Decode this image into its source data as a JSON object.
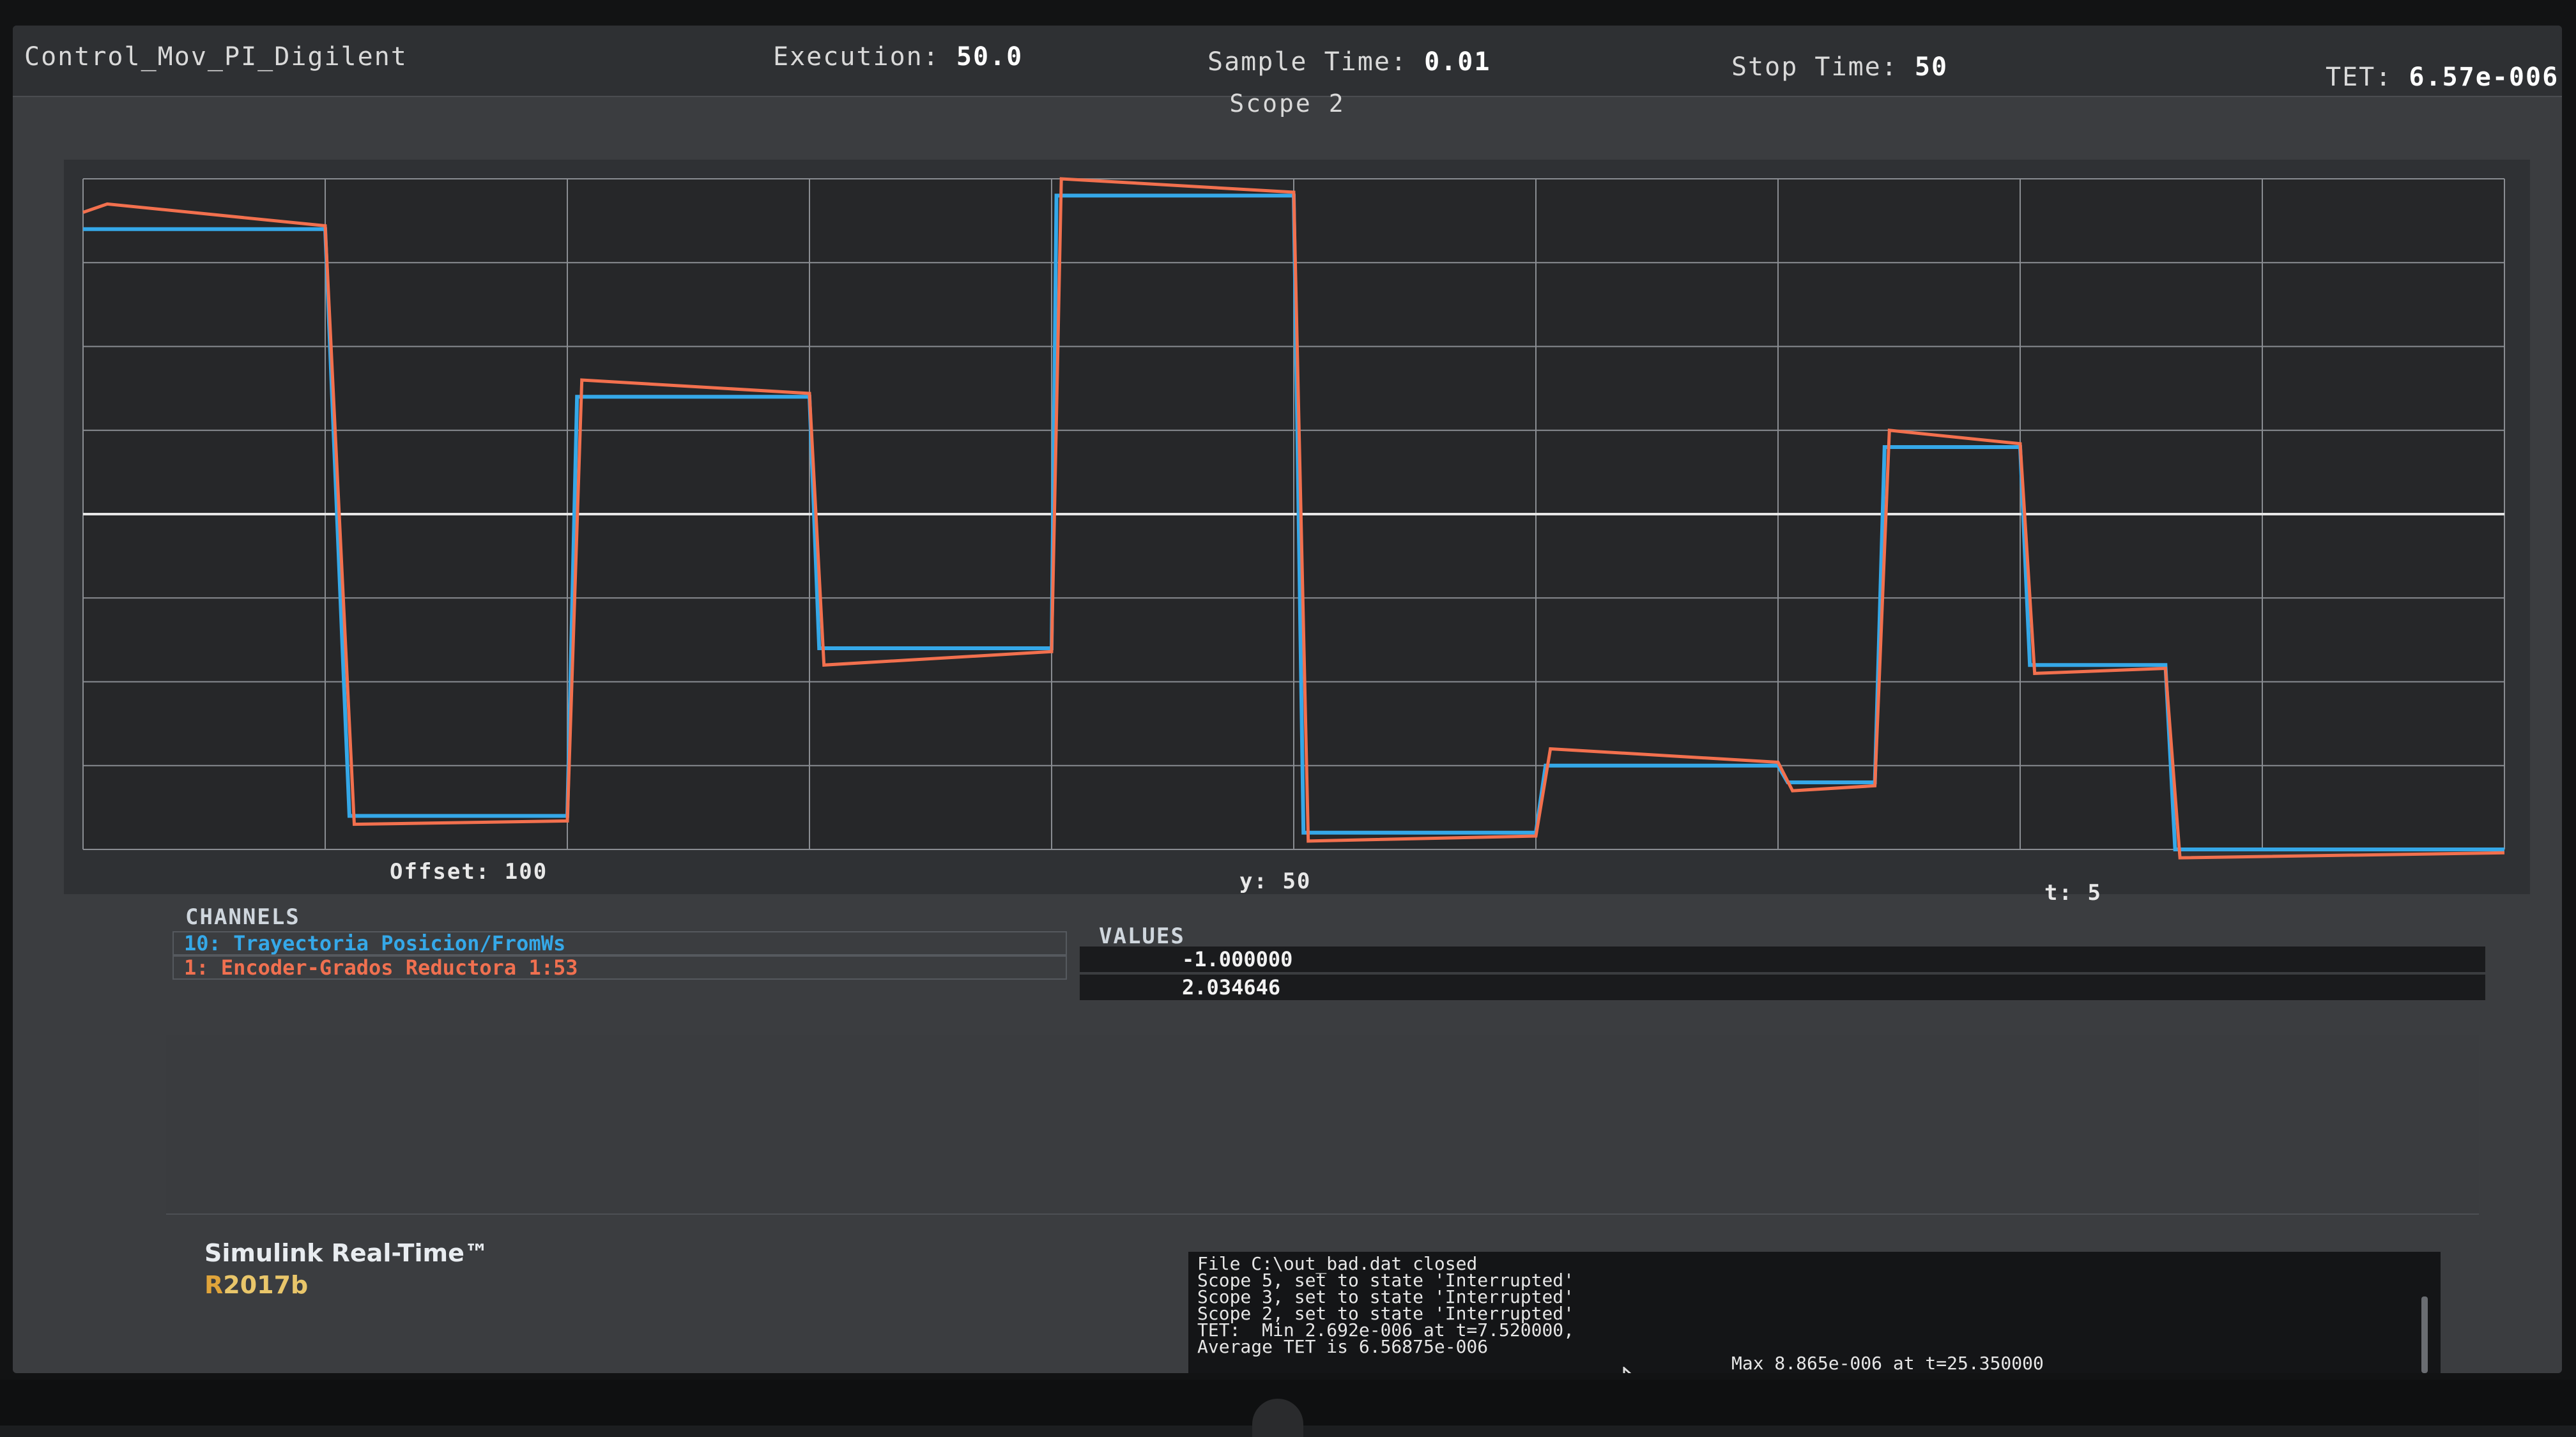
{
  "topbar": {
    "model_name": "Control_Mov_PI_Digilent",
    "execution_label": "Execution:",
    "execution_value": "50.0",
    "sample_time_label": "Sample Time:",
    "sample_time_value": "0.01",
    "stop_time_label": "Stop Time:",
    "stop_time_value": "50",
    "tet_label": "TET:",
    "tet_value": "6.57e-006"
  },
  "scope": {
    "title": "Scope 2",
    "offset_label": "Offset:",
    "offset_value": "100",
    "y_label": "y:",
    "y_value": "50",
    "t_label": "t:",
    "t_value": "5"
  },
  "channels": {
    "header": "CHANNELS",
    "values_header": "VALUES",
    "items": [
      {
        "label": "10: Trayectoria Posicion/FromWs",
        "value": "-1.000000",
        "color": "#35a8e8"
      },
      {
        "label": "1: Encoder-Grados Reductora 1:53",
        "value": "2.034646",
        "color": "#f07050"
      }
    ]
  },
  "brand": {
    "title": "Simulink Real-Time™",
    "release_prefix": "R",
    "release_rest": "2017b"
  },
  "console": {
    "lines": "File C:\\out_bad.dat closed\nScope 5, set to state 'Interrupted'\nScope 3, set to state 'Interrupted'\nScope 2, set to state 'Interrupted'\nTET:  Min 2.692e-006 at t=7.520000,\nAverage TET is 6.56875e-006",
    "side_text": "Max 8.865e-006 at t=25.350000"
  },
  "colors": {
    "trajectory": "#35a8e8",
    "encoder": "#f2704e",
    "grid": "#8a8d92",
    "zero_line": "#e6e6e6"
  },
  "chart_data": {
    "type": "line",
    "title": "Scope 2",
    "xlabel": "",
    "ylabel": "",
    "xlim": [
      0,
      50
    ],
    "ylim": [
      -200,
      200
    ],
    "x_divisions": 10,
    "y_divisions": 8,
    "grid": true,
    "series": [
      {
        "name": "10: Trayectoria Posicion/FromWs",
        "color": "#35a8e8",
        "points": [
          [
            0,
            170
          ],
          [
            5,
            170
          ],
          [
            5.5,
            -180
          ],
          [
            10,
            -180
          ],
          [
            10.2,
            70
          ],
          [
            15,
            70
          ],
          [
            15.2,
            -80
          ],
          [
            20,
            -80
          ],
          [
            20.1,
            190
          ],
          [
            25,
            190
          ],
          [
            25.2,
            -190
          ],
          [
            30,
            -190
          ],
          [
            30.2,
            -150
          ],
          [
            35,
            -150
          ],
          [
            35.2,
            -160
          ],
          [
            37,
            -160
          ],
          [
            37.2,
            40
          ],
          [
            40,
            40
          ],
          [
            40.2,
            -90
          ],
          [
            43,
            -90
          ],
          [
            43.2,
            -200
          ],
          [
            50,
            -200
          ]
        ]
      },
      {
        "name": "1: Encoder-Grados Reductora 1:53",
        "color": "#f2704e",
        "points": [
          [
            0,
            180
          ],
          [
            0.5,
            185
          ],
          [
            5,
            172
          ],
          [
            5.6,
            -185
          ],
          [
            10,
            -183
          ],
          [
            10.3,
            80
          ],
          [
            15,
            72
          ],
          [
            15.3,
            -90
          ],
          [
            20,
            -82
          ],
          [
            20.2,
            200
          ],
          [
            25,
            192
          ],
          [
            25.3,
            -195
          ],
          [
            30,
            -192
          ],
          [
            30.3,
            -140
          ],
          [
            35,
            -148
          ],
          [
            35.3,
            -165
          ],
          [
            37,
            -162
          ],
          [
            37.3,
            50
          ],
          [
            40,
            42
          ],
          [
            40.3,
            -95
          ],
          [
            43,
            -92
          ],
          [
            43.3,
            -205
          ],
          [
            50,
            -202
          ]
        ]
      }
    ]
  }
}
